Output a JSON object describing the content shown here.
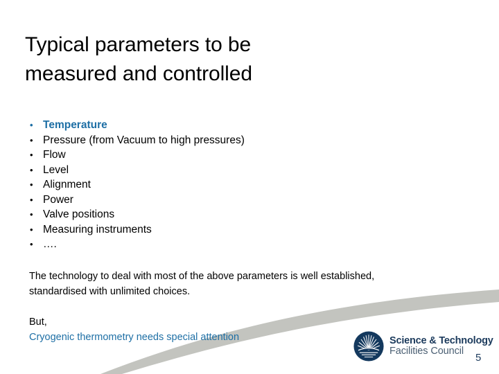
{
  "slide": {
    "background_color": "#ffffff",
    "accent_color": "#1e6fa5",
    "swoosh_color": "#c3c4bf",
    "logo_navy": "#1b3a5c"
  },
  "title": {
    "line1": "Typical parameters to be",
    "line2": "measured and controlled"
  },
  "bullets": {
    "marker": "•",
    "items": [
      {
        "label": "Temperature",
        "accent": true
      },
      {
        "label": "Pressure (from Vacuum to high pressures)",
        "accent": false
      },
      {
        "label": "Flow",
        "accent": false
      },
      {
        "label": "Level",
        "accent": false
      },
      {
        "label": "Alignment",
        "accent": false
      },
      {
        "label": "Power",
        "accent": false
      },
      {
        "label": "Valve positions",
        "accent": false
      },
      {
        "label": "Measuring instruments",
        "accent": false
      },
      {
        "label": "….",
        "accent": false
      }
    ]
  },
  "body": {
    "tech_line1": "The technology to deal with most of the above parameters is well established,",
    "tech_line2": "standardised with unlimited choices.",
    "but_line": "But,",
    "accent_line": "Cryogenic thermometry needs special attention"
  },
  "logo": {
    "name": "stfc-logo",
    "emblem": "sunrise-starburst-icon",
    "line1": "Science & Technology",
    "line2": "Facilities Council"
  },
  "footer": {
    "page_number": "5"
  }
}
